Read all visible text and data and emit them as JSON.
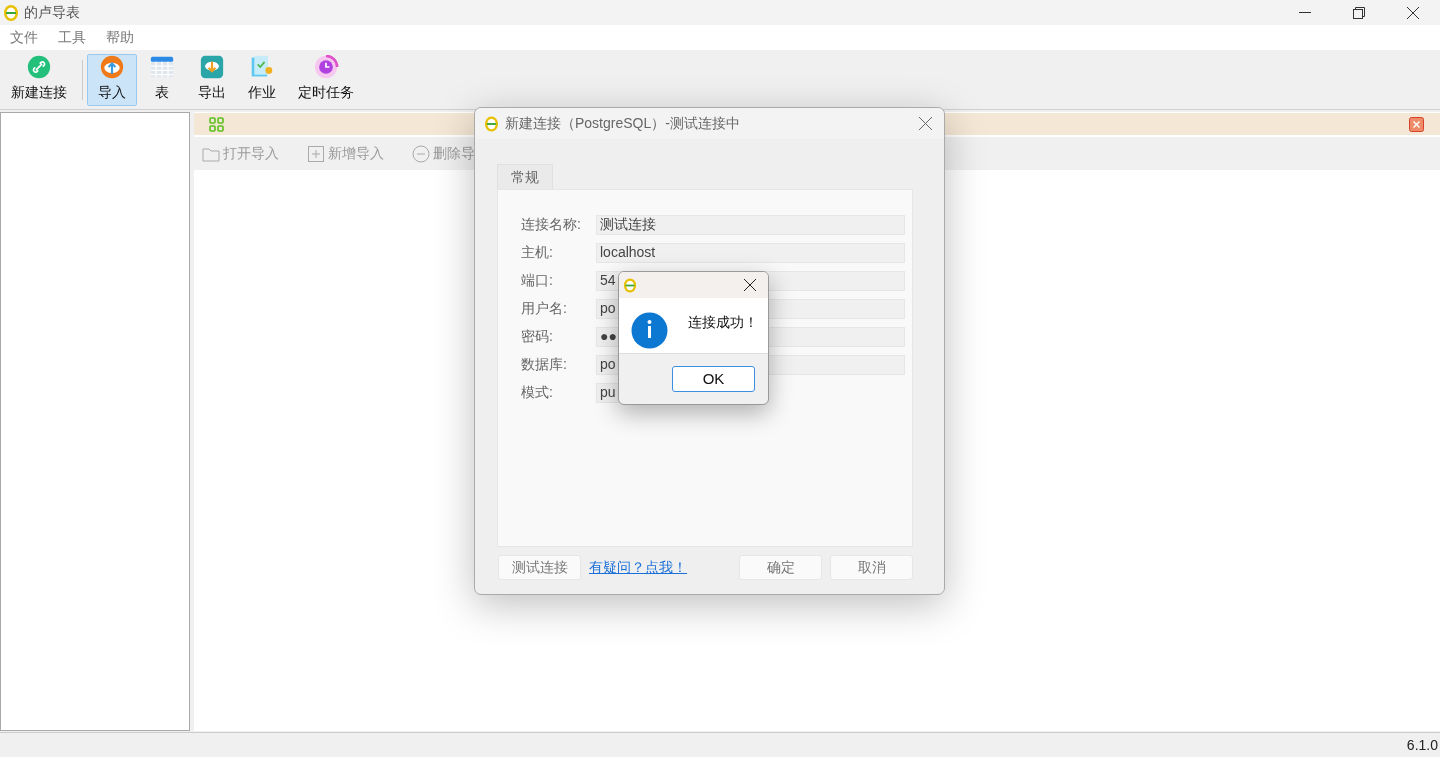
{
  "window": {
    "title": "的卢导表"
  },
  "menu": [
    "文件",
    "工具",
    "帮助"
  ],
  "toolbar": [
    {
      "kind": "link",
      "label": "新建连接",
      "selected": false
    },
    {
      "kind": "import",
      "label": "导入",
      "selected": true
    },
    {
      "kind": "table",
      "label": "表",
      "selected": false
    },
    {
      "kind": "export",
      "label": "导出",
      "selected": false
    },
    {
      "kind": "job",
      "label": "作业",
      "selected": false
    },
    {
      "kind": "timer",
      "label": "定时任务",
      "selected": false
    }
  ],
  "import_actions": [
    {
      "kind": "open",
      "label": "打开导入"
    },
    {
      "kind": "add",
      "label": "新增导入"
    },
    {
      "kind": "remove",
      "label": "删除导"
    }
  ],
  "dialog": {
    "title": "新建连接（PostgreSQL）-测试连接中",
    "tabs": [
      {
        "label": "常规",
        "selected": true
      }
    ],
    "fields": [
      {
        "label": "连接名称:",
        "value": "测试连接"
      },
      {
        "label": "主机:",
        "value": "localhost"
      },
      {
        "label": "端口:",
        "value": "54"
      },
      {
        "label": "用户名:",
        "value": "po"
      },
      {
        "label": "密码:",
        "value": "●●"
      },
      {
        "label": "数据库:",
        "value": "po"
      },
      {
        "label": "模式:",
        "value": "pu",
        "kind": "short"
      }
    ],
    "test_button": "测试连接",
    "help_link": "有疑问？点我！",
    "ok_button": "确定",
    "cancel_button": "取消"
  },
  "message_box": {
    "message": "连接成功！",
    "button": "OK"
  },
  "status_bar": {
    "version": "6.1.0"
  }
}
